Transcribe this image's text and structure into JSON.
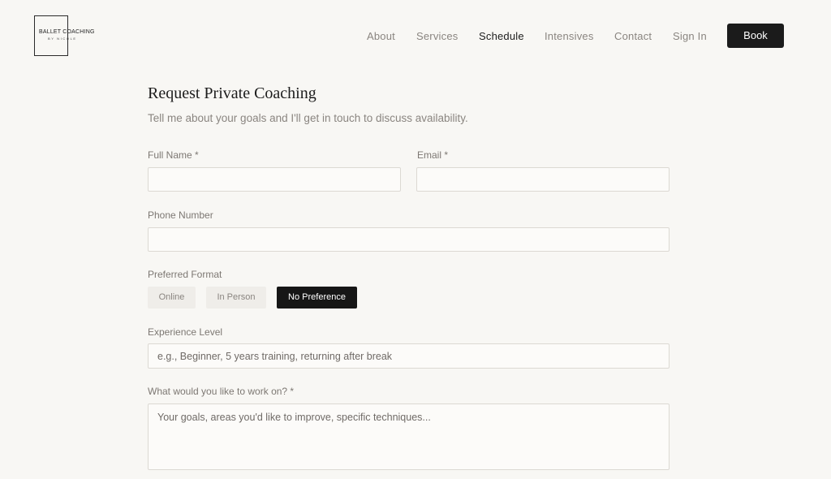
{
  "header": {
    "logo": {
      "title": "BALLET COACHING",
      "subtitle": "BY NICOLE"
    },
    "nav": [
      {
        "label": "About"
      },
      {
        "label": "Services"
      },
      {
        "label": "Schedule",
        "active": true
      },
      {
        "label": "Intensives"
      },
      {
        "label": "Contact"
      },
      {
        "label": "Sign In"
      }
    ],
    "book_label": "Book"
  },
  "form": {
    "title": "Request Private Coaching",
    "subtitle": "Tell me about your goals and I'll get in touch to discuss availability.",
    "full_name": {
      "label": "Full Name *",
      "value": ""
    },
    "email": {
      "label": "Email *",
      "value": ""
    },
    "phone": {
      "label": "Phone Number",
      "value": ""
    },
    "preferred_format": {
      "label": "Preferred Format",
      "options": [
        "Online",
        "In Person",
        "No Preference"
      ],
      "selected": "No Preference"
    },
    "experience": {
      "label": "Experience Level",
      "placeholder": "e.g., Beginner, 5 years training, returning after break"
    },
    "goals": {
      "label": "What would you like to work on? *",
      "placeholder": "Your goals, areas you'd like to improve, specific techniques..."
    }
  },
  "colors": {
    "background": "#f8f7f4",
    "accent": "#1b1b1b",
    "muted_text": "#8a8580"
  }
}
